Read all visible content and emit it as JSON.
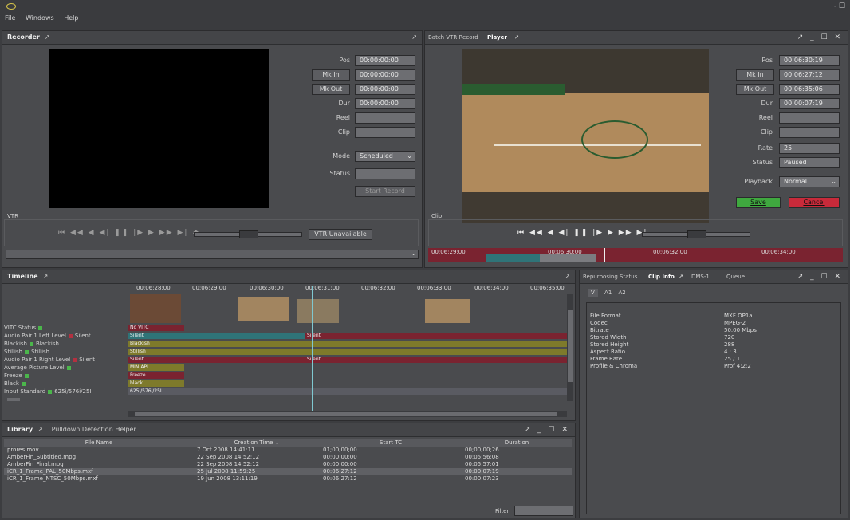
{
  "menu": {
    "items": [
      "File",
      "Windows",
      "Help"
    ],
    "window_ctl": "- ☐"
  },
  "recorder": {
    "title": "Recorder",
    "fields": [
      {
        "label": "Pos",
        "value": "00:00:00:00"
      },
      {
        "label": "Mk In",
        "value": "00:00:00:00"
      },
      {
        "label": "Mk Out",
        "value": "00:00:00:00"
      },
      {
        "label": "Dur",
        "value": "00:00:00:00"
      },
      {
        "label": "Reel",
        "value": ""
      },
      {
        "label": "Clip",
        "value": ""
      }
    ],
    "mode_label": "Mode",
    "mode_value": "Scheduled",
    "status_label": "Status",
    "status_value": "",
    "start_record": "Start Record",
    "vtr_label": "VTR",
    "vtr_unavailable": "VTR Unavailable"
  },
  "player": {
    "tab_batch": "Batch VTR Record",
    "tab_player": "Player",
    "fields": [
      {
        "label": "Pos",
        "value": "00:06:30:19"
      },
      {
        "label": "Mk In",
        "value": "00:06:27:12"
      },
      {
        "label": "Mk Out",
        "value": "00:06:35:06"
      },
      {
        "label": "Dur",
        "value": "00:00:07:19"
      },
      {
        "label": "Reel",
        "value": ""
      },
      {
        "label": "Clip",
        "value": ""
      },
      {
        "label": "Rate",
        "value": "25"
      },
      {
        "label": "Status",
        "value": "Paused"
      }
    ],
    "playback_label": "Playback",
    "playback_value": "Normal",
    "save": "Save",
    "cancel": "Cancel",
    "clip_label": "Clip",
    "timecodes": [
      "00:06:29:00",
      "00:06:30:00",
      "00:06:32:00",
      "00:06:34:00"
    ]
  },
  "timeline": {
    "title": "Timeline",
    "ruler": [
      "00:06:28:00",
      "00:06:29:00",
      "00:06:30:00",
      "00:06:31:00",
      "00:06:32:00",
      "00:06:33:00",
      "00:06:34:00",
      "00:06:35:00"
    ],
    "tracks": [
      {
        "label": "VITC Status",
        "dot": "green",
        "seg": "No VITC",
        "color": "#7a2330",
        "width": 70
      },
      {
        "label": "Audio Pair 1 Left Level",
        "dot": "red",
        "extra": "Silent",
        "seg": "Silent",
        "color": "#2f7478",
        "width": 225,
        "seg2": "Silent",
        "color2": "#7a2330"
      },
      {
        "label": "Blackish",
        "dot": "green",
        "extra": "Blackish",
        "seg": "Blackish",
        "color": "#7e7a2b",
        "width": 555
      },
      {
        "label": "Stillish",
        "dot": "green",
        "extra": "Stillish",
        "seg": "Stillish",
        "color": "#7e7a2b",
        "width": 555
      },
      {
        "label": "Audio Pair 1 Right Level",
        "dot": "red",
        "extra": "Silent",
        "seg": "Silent",
        "color": "#7a2330",
        "width": 225,
        "seg2": "Silent",
        "color2": "#7a2330"
      },
      {
        "label": "Average Picture Level",
        "dot": "green",
        "seg": "MIN APL",
        "color": "#7e7a2b",
        "width": 70
      },
      {
        "label": "Freeze",
        "dot": "green",
        "seg": "Freeze",
        "color": "#7a2330",
        "width": 70
      },
      {
        "label": "Black",
        "dot": "green",
        "seg": "black",
        "color": "#7e7a2b",
        "width": 70
      },
      {
        "label": "Input Standard",
        "dot": "green",
        "extra": "625i/576i/25I",
        "seg": "625i/576i/25I",
        "color": "#5a5b62",
        "width": 555
      }
    ]
  },
  "library": {
    "title": "Library",
    "tab2": "Pulldown Detection Helper",
    "columns": [
      "File Name",
      "Creation Time",
      "Start TC",
      "Duration"
    ],
    "rows": [
      [
        "prores.mov",
        "7 Oct 2008 14:41:11",
        "01;00;00;00",
        "00;00;00;26"
      ],
      [
        "AmberFin_Subtitled.mpg",
        "22 Sep 2008 14:52:12",
        "00:00:00:00",
        "00:05:56:08"
      ],
      [
        "AmberFin_Final.mpg",
        "22 Sep 2008 14:52:12",
        "00:00:00:00",
        "00:05:57:01"
      ],
      [
        "iCR_1_Frame_PAL_50Mbps.mxf",
        "25 Jul 2008 11:59:25",
        "00:06:27:12",
        "00:00:07:19"
      ],
      [
        "iCR_1_Frame_NTSC_50Mbps.mxf",
        "19 Jun 2008 13:11:19",
        "00:06:27:12",
        "00:00:07:23"
      ]
    ],
    "filter_label": "Filter"
  },
  "clipinfo": {
    "tabs": [
      "Repurposing Status",
      "Clip Info",
      "DMS-1",
      "Queue"
    ],
    "subtabs": [
      "V",
      "A1",
      "A2"
    ],
    "rows": [
      [
        "File Format",
        "MXF OP1a"
      ],
      [
        "Codec",
        "MPEG-2"
      ],
      [
        "Bitrate",
        "50.00 Mbps"
      ],
      [
        "Stored Width",
        "720"
      ],
      [
        "Stored Height",
        "288"
      ],
      [
        "Aspect Ratio",
        "4 : 3"
      ],
      [
        "Frame Rate",
        "25 / 1"
      ],
      [
        "Profile & Chroma",
        "Prof 4:2:2"
      ]
    ]
  }
}
